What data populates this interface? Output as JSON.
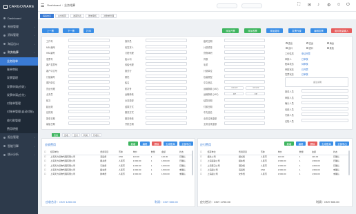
{
  "app": {
    "logo": "CARGOWARE"
  },
  "sidebar": {
    "items": [
      {
        "label": "Dashboard"
      },
      {
        "label": "系统管理"
      },
      {
        "label": "资料管理"
      },
      {
        "label": "海运出口"
      },
      {
        "label": "财务结算"
      }
    ],
    "sub": [
      {
        "label": "业务账单"
      },
      {
        "label": "账单审核"
      },
      {
        "label": "发票管理"
      },
      {
        "label": "发票申请(应收)"
      },
      {
        "label": "发票申请(应付)"
      },
      {
        "label": "对账单管理"
      },
      {
        "label": "对账单管理(自动对账)"
      },
      {
        "label": "收付款管理"
      },
      {
        "label": "费用明细"
      }
    ],
    "bottom": [
      {
        "label": "报告管理"
      },
      {
        "label": "智能引擎"
      },
      {
        "label": "统计分析"
      }
    ]
  },
  "header": {
    "breadcrumb_root": "Dashboard",
    "breadcrumb_current": "业务结算"
  },
  "tabs": [
    "海运出口",
    "业务结算",
    "发票列表",
    "账单审核",
    "对账单管理"
  ],
  "toolbar": {
    "left": [
      "上一票",
      "下一票",
      "打印"
    ],
    "right": [
      "添加开票",
      "添加收票",
      "添加费用",
      "发票作废",
      "编辑发票",
      "费用批量输入"
    ]
  },
  "form": {
    "col1": [
      "工作号",
      "MBL编号",
      "HBL编号",
      "发票号",
      "客户发票号",
      "客户中文号",
      "订舱编号",
      "委托单位",
      "货运代理",
      "业务员",
      "航次",
      "起运港",
      "目的港",
      "提单日期",
      "装船日期"
    ],
    "col2": [
      "操作员",
      "收发货人",
      "订舱代理",
      "船公司",
      "驳船代理",
      "报关行",
      "委托",
      "船名",
      "航次号",
      "运输条款",
      "业务类型",
      "结算方式",
      "服务方式",
      "服务条款",
      "开航日期"
    ],
    "col3": [
      "截关日期",
      "计费重量",
      "货物体积",
      "件数",
      "毛重",
      "计费单位",
      "包装类型",
      "中文品名",
      "运输条款 (VAT)",
      "运输条款 (VAT)",
      "结算日期",
      "付款日期",
      "中文品名",
      "业务往来金额",
      "业务往来金额"
    ],
    "col3_sel": [
      "CY-CY",
      "CY-CY",
      "FP",
      "FP"
    ],
    "radios": [
      "进出",
      "空运",
      "海运",
      "出口",
      "进口",
      "其他"
    ],
    "col4_labels": [
      "工作性质",
      "审核人",
      "账单状态",
      "审核状态",
      "发票状态"
    ],
    "col4_values": [
      "申请开票",
      "已审核",
      "待审核",
      "已开票",
      "已审核"
    ],
    "remark_label": "备注说明",
    "col4b": [
      "制单人员",
      "审核人员",
      "确认人员",
      "收款人员",
      "付款人员",
      "记账人员"
    ]
  },
  "categories": [
    "费用",
    "应收",
    "应付",
    "利润",
    "代收付"
  ],
  "receivable": {
    "title": "应收费用",
    "buttons": [
      "新增",
      "编辑",
      "删除",
      "生成账单",
      "全部导出"
    ],
    "columns": [
      "结算单位",
      "费用项目",
      "币种",
      "单价",
      "数量",
      "金额",
      "状态"
    ],
    "rows": [
      [
        "上海天力货物代理有限公司",
        "海运费",
        "USD",
        "120.00",
        "1",
        "120.00",
        "已确认"
      ],
      [
        "上海天力货物代理有限公司",
        "报关费",
        "人民币",
        "1,500.00",
        "1",
        "1,500.00",
        "已确认"
      ],
      [
        "上海天力货物代理有限公司",
        "订舱费",
        "人民币",
        "1,500.00",
        "1",
        "1,500.00",
        "已确认"
      ],
      [
        "上海天力货物代理有限公司",
        "拖车费",
        "人民币",
        "1,500.00",
        "1",
        "1,500.00",
        "未确认"
      ],
      [
        "上海天力货物代理有限公司",
        "换单费",
        "人民币",
        "1,500.00",
        "1",
        "1,500.00",
        "未确认"
      ]
    ],
    "footer_left": "应收合计：CNY 1200.00",
    "footer_right": "利润：CNY 500.00"
  },
  "payable": {
    "title": "应付费用",
    "buttons": [
      "新增",
      "编辑",
      "删除",
      "生成账单",
      "全部导出"
    ],
    "columns": [
      "结算单位",
      "费用项目",
      "币种",
      "单价",
      "数量",
      "金额",
      "状态"
    ],
    "rows": [
      [
        "报关公司",
        "报关费",
        "人民币",
        "120.00",
        "1",
        "120.00",
        "已确认"
      ],
      [
        "上海运输公司",
        "拖车费",
        "人民币",
        "1,500.00",
        "1",
        "1,500.00",
        "已确认"
      ],
      [
        "上海港口公司",
        "港杂费",
        "人民币",
        "1,500.00",
        "1",
        "1,500.00",
        "已确认"
      ],
      [
        "上海船公司",
        "海运费",
        "USD",
        "1,500.00",
        "1",
        "1,500.00",
        "未确认"
      ],
      [
        "上海船公司",
        "文件费",
        "人民币",
        "1,500.00",
        "1",
        "1,500.00",
        "未确认"
      ]
    ],
    "footer_left": "应付合计：CNY 1700.00",
    "footer_right": "利润：CNY 500.00"
  }
}
